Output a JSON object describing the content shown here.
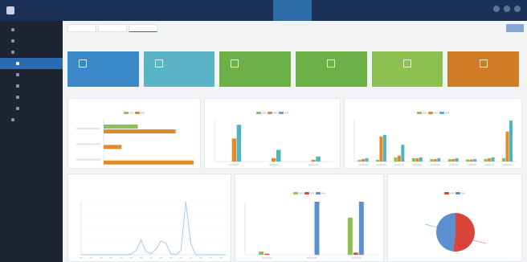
{
  "colors": {
    "topbar": "#1b3056",
    "sidebar": "#1e2431",
    "accent_blue": "#2b6cb0",
    "card_blue": "#3a88c8",
    "card_teal": "#5bb4c6",
    "card_green": "#6eb048",
    "card_orange": "#d07b25",
    "series_green": "#8cc152",
    "series_orange": "#e08a2a",
    "series_teal": "#4fb3c2",
    "series_red": "#d9453a",
    "series_blue": "#5b8fcf"
  },
  "app": {
    "logo_text": ""
  },
  "nav": {
    "tabs": [
      {
        "label": ""
      },
      {
        "label": ""
      },
      {
        "label": ""
      },
      {
        "label": ""
      },
      {
        "label": ""
      },
      {
        "label": "",
        "active": true
      },
      {
        "label": ""
      }
    ],
    "right_text": ""
  },
  "sidebar": {
    "items": [
      {
        "label": "",
        "sub": false,
        "active": false
      },
      {
        "label": "",
        "sub": false,
        "active": false
      },
      {
        "label": "",
        "sub": false,
        "active": false
      },
      {
        "label": "",
        "sub": true,
        "active": true
      },
      {
        "label": "",
        "sub": true,
        "active": false
      },
      {
        "label": "",
        "sub": true,
        "active": false
      },
      {
        "label": "",
        "sub": true,
        "active": false
      },
      {
        "label": "",
        "sub": true,
        "active": false
      },
      {
        "label": "",
        "sub": false,
        "active": false
      }
    ]
  },
  "breadcrumbs": [
    {
      "label": ""
    },
    {
      "label": ""
    },
    {
      "label": "",
      "active": true
    }
  ],
  "section_label": "",
  "cards": [
    {
      "label": "",
      "value": "",
      "sub": "",
      "color": "#3a88c8",
      "icon": "monitor-icon",
      "center": false
    },
    {
      "label": "",
      "value": "",
      "sub": "",
      "color": "#5bb4c6",
      "icon": "folder-icon",
      "center": false
    },
    {
      "label": "",
      "value": "",
      "sub": "",
      "color": "#6eb048",
      "icon": "chart-icon",
      "center": false
    },
    {
      "label": "",
      "value": "",
      "sub": "",
      "color": "#6eb048",
      "icon": "document-icon",
      "center": true
    },
    {
      "label": "",
      "value": "",
      "sub": "",
      "color": "#8cc152",
      "icon": "grid-icon",
      "center": true
    },
    {
      "label": "",
      "value": "",
      "sub": "",
      "color": "#d07b25",
      "icon": "alert-icon",
      "center": true
    }
  ],
  "panels": {
    "p1": {
      "title": "",
      "tools": ""
    },
    "p2": {
      "title": "",
      "tools": ""
    },
    "p3": {
      "title": "",
      "tools": ""
    },
    "p4": {
      "title": "",
      "tools": ""
    },
    "p5": {
      "title": "",
      "tools": ""
    },
    "p6": {
      "title": "",
      "tools": ""
    }
  },
  "chart_data": [
    {
      "type": "bar",
      "orientation": "horizontal",
      "categories": [
        "",
        "",
        ""
      ],
      "series": [
        {
          "color": "#8cc152",
          "values": [
            38,
            0,
            0
          ]
        },
        {
          "color": "#e08a2a",
          "values": [
            80,
            20,
            100
          ]
        }
      ],
      "xlim": [
        0,
        100
      ]
    },
    {
      "type": "bar",
      "categories": [
        "",
        "",
        ""
      ],
      "series": [
        {
          "color": "#8cc152",
          "values": [
            0,
            0,
            0
          ]
        },
        {
          "color": "#e08a2a",
          "values": [
            55,
            8,
            4
          ]
        },
        {
          "color": "#4fb3c2",
          "values": [
            88,
            28,
            12
          ]
        }
      ],
      "ylim": [
        0,
        100
      ]
    },
    {
      "type": "bar",
      "categories": [
        "",
        "",
        "",
        "",
        "",
        "",
        "",
        "",
        ""
      ],
      "series": [
        {
          "color": "#8cc152",
          "values": [
            4,
            4,
            10,
            8,
            6,
            6,
            5,
            6,
            8
          ]
        },
        {
          "color": "#e08a2a",
          "values": [
            6,
            60,
            14,
            8,
            6,
            6,
            5,
            8,
            72
          ]
        },
        {
          "color": "#4fb3c2",
          "values": [
            8,
            64,
            40,
            10,
            8,
            8,
            6,
            10,
            98
          ]
        }
      ],
      "ylim": [
        0,
        100
      ]
    },
    {
      "type": "line",
      "x": [
        1,
        2,
        3,
        4,
        5,
        6,
        7,
        8,
        9,
        10,
        11,
        12,
        13,
        14,
        15,
        16,
        17,
        18,
        19,
        20,
        21,
        22,
        23,
        24,
        25,
        26,
        27,
        28,
        29,
        30
      ],
      "series": [
        {
          "color": "#9ec5ea",
          "values": [
            0,
            0,
            0,
            0,
            0,
            0,
            0,
            0,
            0,
            0,
            1,
            8,
            28,
            6,
            2,
            10,
            26,
            22,
            2,
            0,
            8,
            100,
            20,
            0,
            0,
            0,
            0,
            0,
            0,
            0
          ]
        }
      ],
      "ylim": [
        0,
        100
      ]
    },
    {
      "type": "bar",
      "categories": [
        "",
        "",
        ""
      ],
      "series": [
        {
          "color": "#8cc152",
          "values": [
            6,
            0,
            70
          ]
        },
        {
          "color": "#d9453a",
          "values": [
            2,
            0,
            4
          ]
        },
        {
          "color": "#5b8fcf",
          "values": [
            0,
            100,
            100
          ]
        }
      ],
      "ylim": [
        0,
        100
      ]
    },
    {
      "type": "pie",
      "slices": [
        {
          "value": 52,
          "color": "#d9453a"
        },
        {
          "value": 48,
          "color": "#5b8fcf"
        }
      ]
    }
  ]
}
